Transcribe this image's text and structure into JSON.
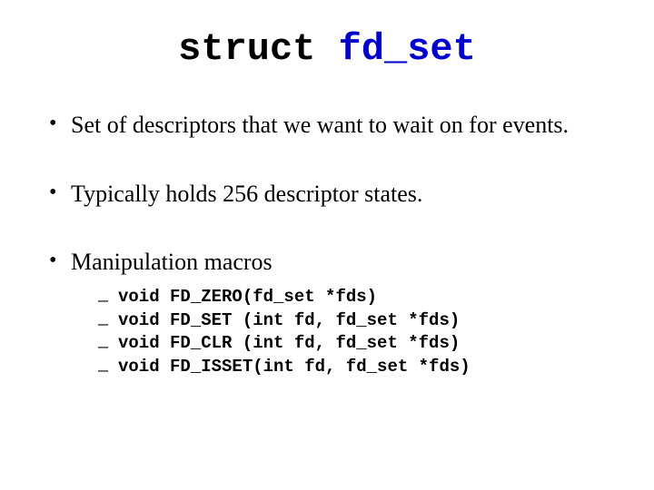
{
  "title": {
    "keyword": "struct",
    "identifier": "fd_set"
  },
  "bullets": [
    {
      "text": "Set of descriptors that we want to wait on for events."
    },
    {
      "text": "Typically holds 256 descriptor states."
    },
    {
      "text": "Manipulation macros"
    }
  ],
  "macros": [
    "void FD_ZERO(fd_set *fds)",
    "void FD_SET (int fd, fd_set *fds)",
    "void FD_CLR (int fd, fd_set *fds)",
    "void FD_ISSET(int fd, fd_set *fds)"
  ]
}
